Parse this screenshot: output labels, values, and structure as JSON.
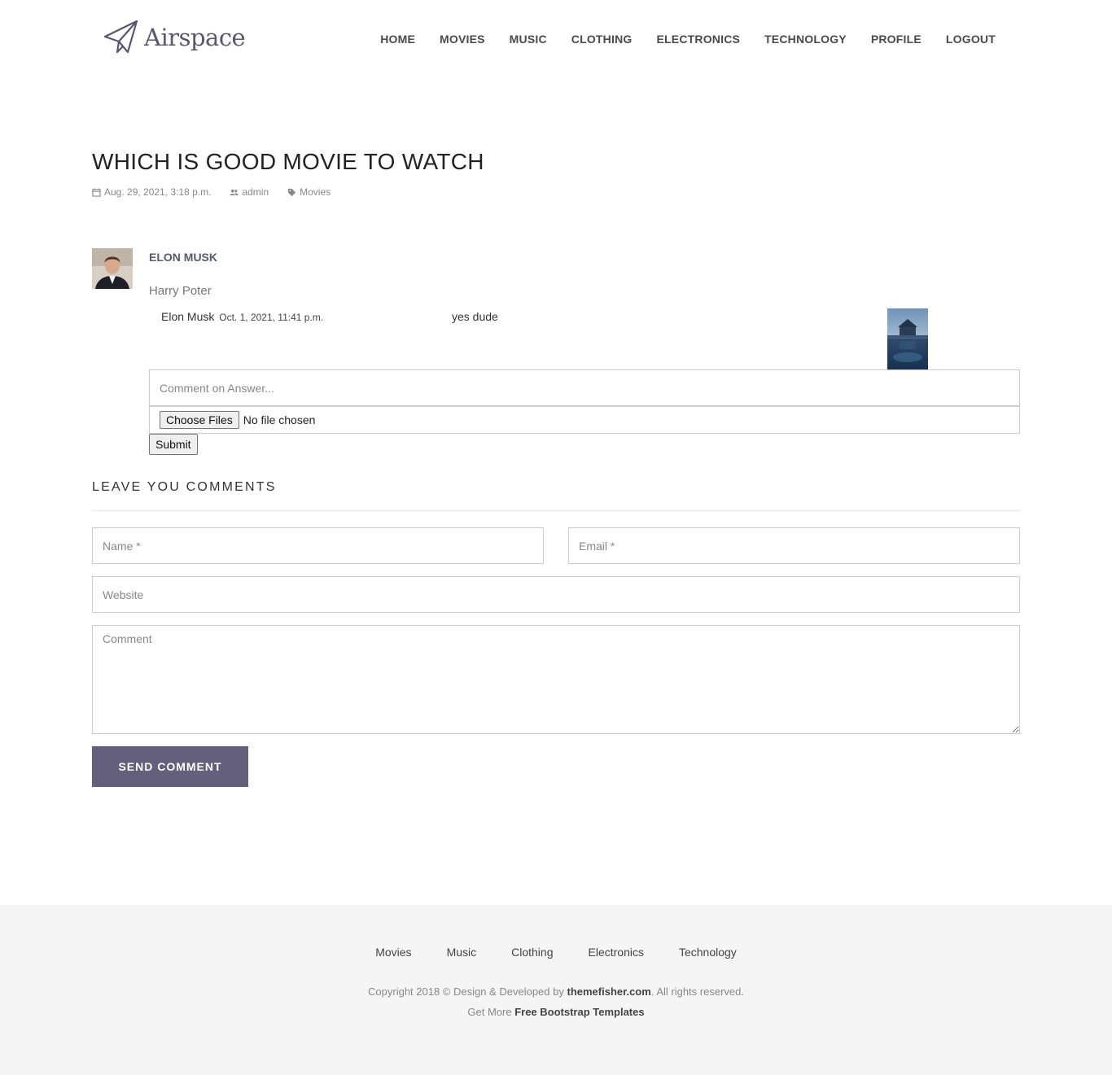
{
  "header": {
    "logo_text": "Airspace",
    "nav": [
      "HOME",
      "MOVIES",
      "MUSIC",
      "CLOTHING",
      "ELECTRONICS",
      "TECHNOLOGY",
      "PROFILE",
      "LOGOUT"
    ]
  },
  "post": {
    "title": "WHICH IS GOOD MOVIE TO WATCH",
    "date": "Aug. 29, 2021, 3:18 p.m.",
    "author": "admin",
    "category": "Movies"
  },
  "comment": {
    "author": "ELON MUSK",
    "text": "Harry Poter",
    "reply": {
      "author": "Elon Musk",
      "date": "Oct. 1, 2021, 11:41 p.m.",
      "text": "yes dude"
    },
    "answer_placeholder": "Comment on Answer...",
    "file_button": "Choose Files",
    "file_status": "No file chosen",
    "submit_label": "Submit"
  },
  "leave": {
    "title": "LEAVE YOU COMMENTS",
    "name_placeholder": "Name *",
    "email_placeholder": "Email *",
    "website_placeholder": "Website",
    "comment_placeholder": "Comment",
    "send_label": "SEND COMMENT"
  },
  "footer": {
    "links": [
      "Movies",
      "Music",
      "Clothing",
      "Electronics",
      "Technology"
    ],
    "copyright_prefix": "Copyright 2018 © Design & Developed by ",
    "copyright_link": "themefisher.com",
    "copyright_suffix": ". All rights reserved.",
    "more_prefix": "Get More ",
    "more_link": "Free Bootstrap Templates"
  },
  "colors": {
    "accent": "#645f7c",
    "footer_bg": "#f5f5f5"
  },
  "icons": [
    "paper-plane-logo-icon",
    "calendar-icon",
    "users-icon",
    "tag-icon"
  ]
}
